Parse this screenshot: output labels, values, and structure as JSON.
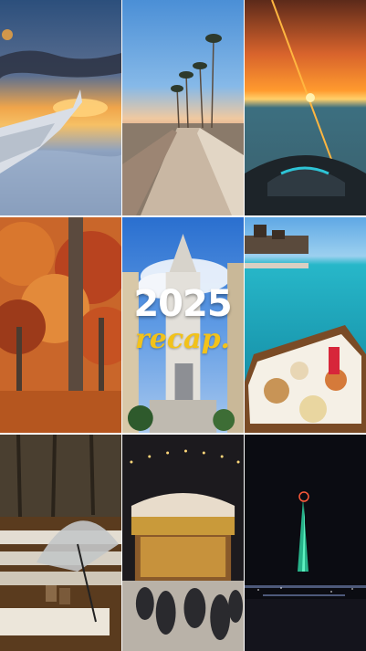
{
  "overlay": {
    "year": "2025",
    "subtitle": "recap."
  },
  "photos": [
    {
      "id": "airplane-wing-sunset"
    },
    {
      "id": "palm-tree-pier-walkway"
    },
    {
      "id": "jetski-sunset-sea"
    },
    {
      "id": "autumn-forest"
    },
    {
      "id": "church-blue-sky"
    },
    {
      "id": "infinity-pool-breakfast-tray"
    },
    {
      "id": "rainy-park-bench-umbrella"
    },
    {
      "id": "christmas-market-carousel"
    },
    {
      "id": "night-lighted-tree-tower"
    }
  ]
}
